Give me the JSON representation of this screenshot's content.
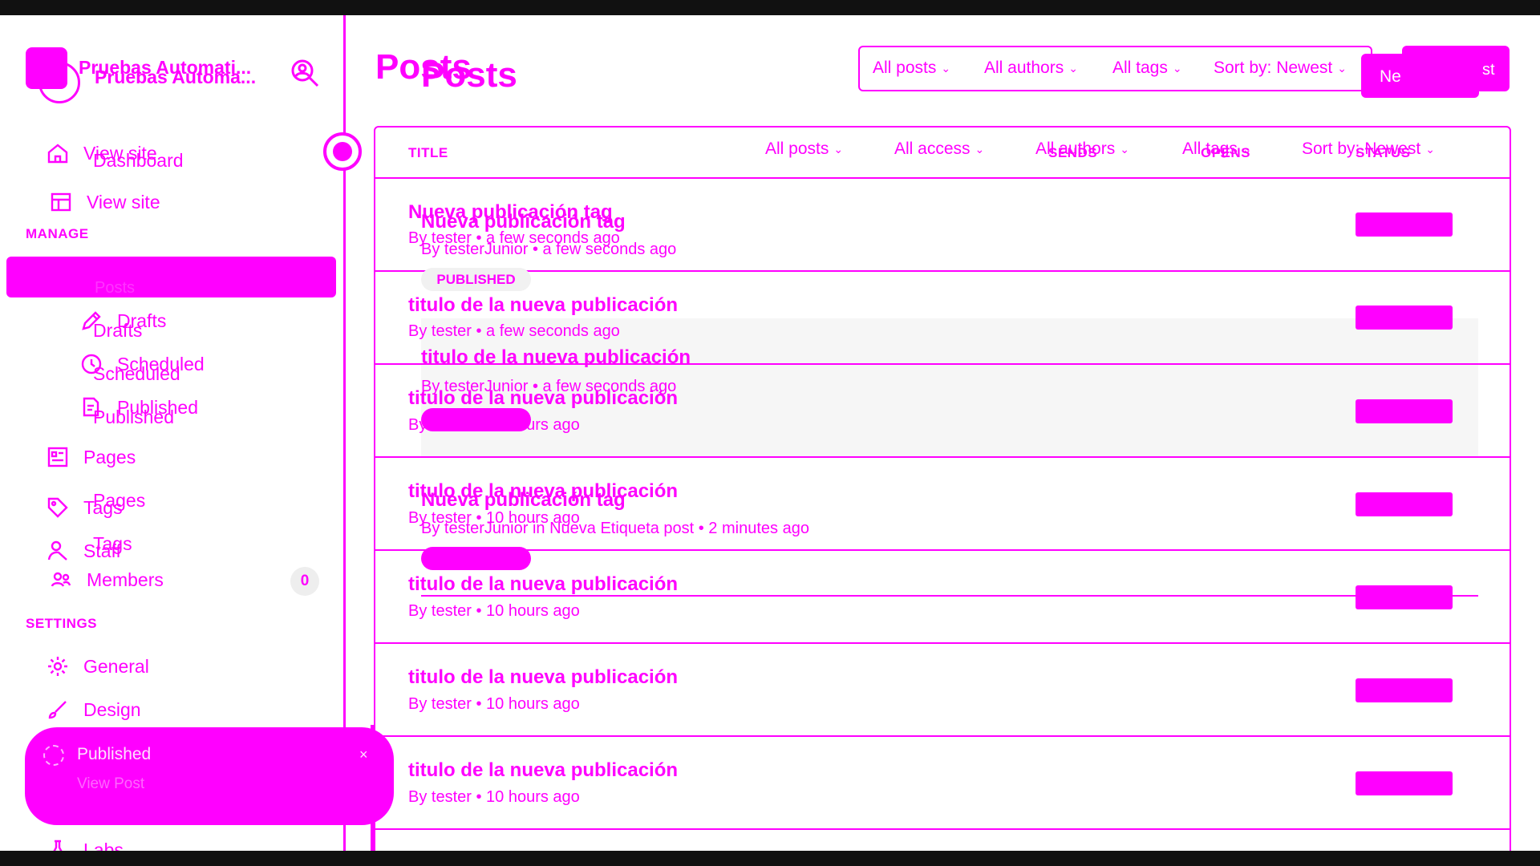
{
  "app": {
    "site_name": "Pruebas Automati...",
    "site_name_ghost": "Pruebas Automa..."
  },
  "sidebar": {
    "view_site_ghost": "View site",
    "dashboard": "Dashboard",
    "view_site": "View site",
    "manage_label": "MANAGE",
    "posts": "Posts",
    "drafts": "Drafts",
    "drafts_ghost": "Drafts",
    "scheduled": "Scheduled",
    "scheduled_ghost": "Scheduled",
    "published": "Published",
    "published_ghost": "Published",
    "pages": "Pages",
    "pages_ghost": "Pages",
    "tags": "Tags",
    "tags_ghost": "Tags",
    "staff": "Staff",
    "members": "Members",
    "members_count": "0",
    "settings_label": "SETTINGS",
    "general": "General",
    "design": "Design",
    "labs": "Labs"
  },
  "toast": {
    "title": "Published",
    "link": "View Post",
    "close": "×"
  },
  "header": {
    "title": "Posts",
    "title_ghost": "Posts",
    "filters": [
      "All posts",
      "All authors",
      "All tags",
      "Sort by: Newest"
    ],
    "new_label": "Ne",
    "new_tail": "st"
  },
  "table": {
    "col_title": "TITLE",
    "col_sends": "SENDS",
    "col_opens": "OPENS",
    "col_status": "STATUS",
    "inline_filters": [
      "All posts",
      "All access",
      "All authors",
      "All tags",
      "Sort by: Newest"
    ],
    "rows": [
      {
        "title": "Nueva publicación tag",
        "meta": "By tester • a few seconds ago"
      },
      {
        "title": "titulo de la nueva publicación",
        "meta": "By tester • a few seconds ago"
      },
      {
        "title": "titulo de la nueva publicación",
        "meta": "By tester • 10 hours ago"
      },
      {
        "title": "titulo de la nueva publicación",
        "meta": "By tester • 10 hours ago"
      },
      {
        "title": "titulo de la nueva publicación",
        "meta": "By tester • 10 hours ago"
      },
      {
        "title": "titulo de la nueva publicación",
        "meta": "By tester • 10 hours ago"
      },
      {
        "title": "titulo de la nueva publicación",
        "meta": "By tester • 10 hours ago"
      }
    ],
    "ghost_rows": [
      {
        "title": "Nueva publicación tag",
        "meta": "By testerJunior • a few seconds ago",
        "badge": "PUBLISHED"
      },
      {
        "title": "titulo de la nueva publicación",
        "meta": "By testerJunior • a few seconds ago"
      },
      {
        "title": "Nueva publicación tag",
        "meta": "By testerJunior in Nueva Etiqueta post • 2 minutes ago"
      }
    ]
  }
}
